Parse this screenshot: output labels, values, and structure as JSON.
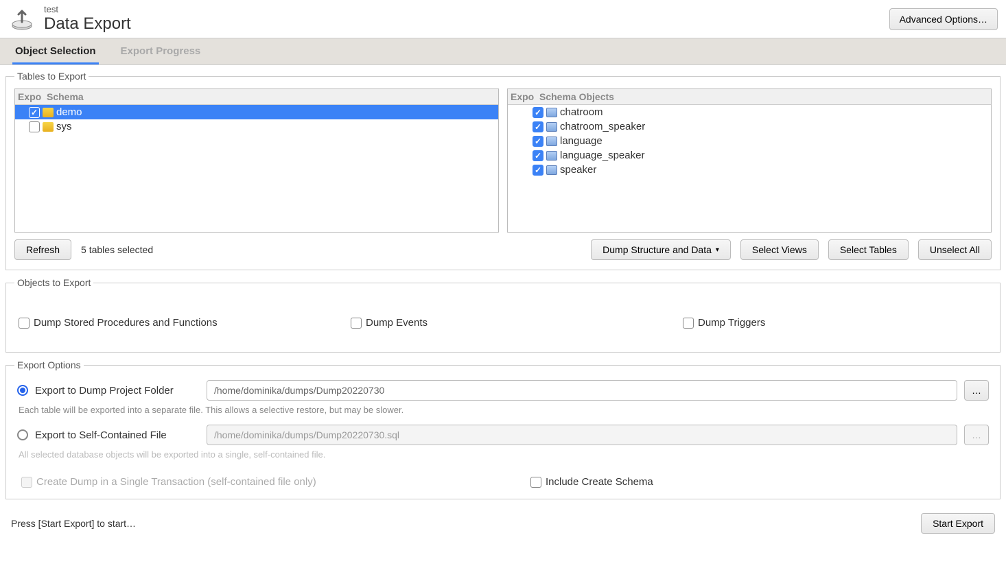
{
  "header": {
    "subtitle": "test",
    "title": "Data Export",
    "advanced_btn": "Advanced Options…"
  },
  "tabs": [
    {
      "label": "Object Selection",
      "active": true
    },
    {
      "label": "Export Progress",
      "active": false
    }
  ],
  "tables_section": {
    "legend": "Tables to Export",
    "schema_header_col1": "Expo",
    "schema_header_col2": "Schema",
    "objects_header_col1": "Expo",
    "objects_header_col2": "Schema Objects",
    "schemas": [
      {
        "name": "demo",
        "checked": true,
        "selected": true
      },
      {
        "name": "sys",
        "checked": false,
        "selected": false
      }
    ],
    "objects": [
      {
        "name": "chatroom",
        "checked": true
      },
      {
        "name": "chatroom_speaker",
        "checked": true
      },
      {
        "name": "language",
        "checked": true
      },
      {
        "name": "language_speaker",
        "checked": true
      },
      {
        "name": "speaker",
        "checked": true
      }
    ],
    "refresh_btn": "Refresh",
    "selected_text": "5 tables selected",
    "dump_dropdown": "Dump Structure and Data",
    "select_views_btn": "Select Views",
    "select_tables_btn": "Select Tables",
    "unselect_all_btn": "Unselect All"
  },
  "objects_section": {
    "legend": "Objects to Export",
    "opts": [
      {
        "label": "Dump Stored Procedures and Functions",
        "checked": false
      },
      {
        "label": "Dump Events",
        "checked": false
      },
      {
        "label": "Dump Triggers",
        "checked": false
      }
    ]
  },
  "export_options": {
    "legend": "Export Options",
    "project_folder": {
      "label": "Export to Dump Project Folder",
      "path": "/home/dominika/dumps/Dump20220730",
      "hint": "Each table will be exported into a separate file. This allows a selective restore, but may be slower."
    },
    "self_contained": {
      "label": "Export to Self-Contained File",
      "path": "/home/dominika/dumps/Dump20220730.sql",
      "hint": "All selected database objects will be exported into a single, self-contained file."
    },
    "single_tx": "Create Dump in a Single Transaction (self-contained file only)",
    "include_schema": "Include Create Schema",
    "browse": "…"
  },
  "footer": {
    "status": "Press [Start Export] to start…",
    "start_btn": "Start Export"
  }
}
